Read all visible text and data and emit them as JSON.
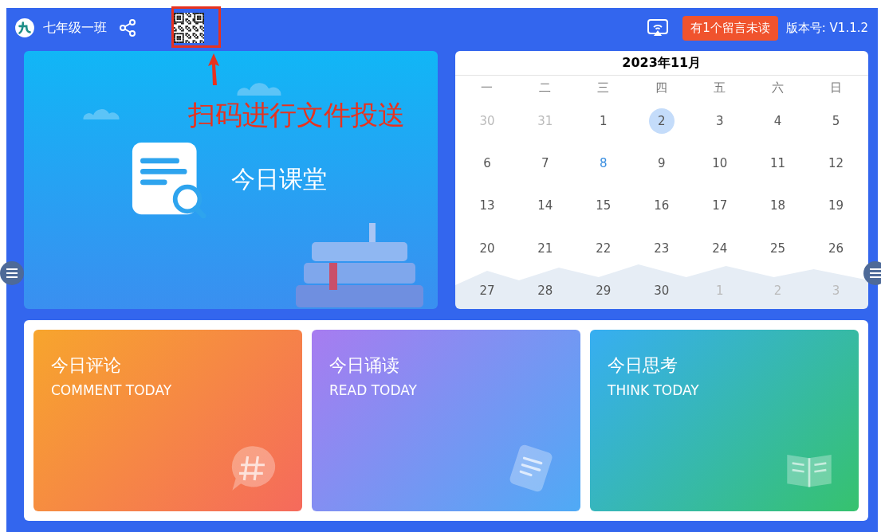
{
  "header": {
    "class_name": "七年级一班",
    "message_badge": "有1个留言未读",
    "version": "版本号: V1.1.2"
  },
  "annotation": {
    "text": "扫码进行文件投送"
  },
  "today_card": {
    "title": "今日课堂"
  },
  "calendar": {
    "title": "2023年11月",
    "weekdays": [
      "一",
      "二",
      "三",
      "四",
      "五",
      "六",
      "日"
    ],
    "weeks": [
      [
        {
          "label": "30",
          "outside": true,
          "selected": false,
          "marked": false
        },
        {
          "label": "31",
          "outside": true,
          "selected": false,
          "marked": false
        },
        {
          "label": "1",
          "outside": false,
          "selected": false,
          "marked": false
        },
        {
          "label": "2",
          "outside": false,
          "selected": true,
          "marked": false
        },
        {
          "label": "3",
          "outside": false,
          "selected": false,
          "marked": false
        },
        {
          "label": "4",
          "outside": false,
          "selected": false,
          "marked": false
        },
        {
          "label": "5",
          "outside": false,
          "selected": false,
          "marked": false
        }
      ],
      [
        {
          "label": "6",
          "outside": false,
          "selected": false,
          "marked": false
        },
        {
          "label": "7",
          "outside": false,
          "selected": false,
          "marked": false
        },
        {
          "label": "8",
          "outside": false,
          "selected": false,
          "marked": true
        },
        {
          "label": "9",
          "outside": false,
          "selected": false,
          "marked": false
        },
        {
          "label": "10",
          "outside": false,
          "selected": false,
          "marked": false
        },
        {
          "label": "11",
          "outside": false,
          "selected": false,
          "marked": false
        },
        {
          "label": "12",
          "outside": false,
          "selected": false,
          "marked": false
        }
      ],
      [
        {
          "label": "13",
          "outside": false,
          "selected": false,
          "marked": false
        },
        {
          "label": "14",
          "outside": false,
          "selected": false,
          "marked": false
        },
        {
          "label": "15",
          "outside": false,
          "selected": false,
          "marked": false
        },
        {
          "label": "16",
          "outside": false,
          "selected": false,
          "marked": false
        },
        {
          "label": "17",
          "outside": false,
          "selected": false,
          "marked": false
        },
        {
          "label": "18",
          "outside": false,
          "selected": false,
          "marked": false
        },
        {
          "label": "19",
          "outside": false,
          "selected": false,
          "marked": false
        }
      ],
      [
        {
          "label": "20",
          "outside": false,
          "selected": false,
          "marked": false
        },
        {
          "label": "21",
          "outside": false,
          "selected": false,
          "marked": false
        },
        {
          "label": "22",
          "outside": false,
          "selected": false,
          "marked": false
        },
        {
          "label": "23",
          "outside": false,
          "selected": false,
          "marked": false
        },
        {
          "label": "24",
          "outside": false,
          "selected": false,
          "marked": false
        },
        {
          "label": "25",
          "outside": false,
          "selected": false,
          "marked": false
        },
        {
          "label": "26",
          "outside": false,
          "selected": false,
          "marked": false
        }
      ],
      [
        {
          "label": "27",
          "outside": false,
          "selected": false,
          "marked": false
        },
        {
          "label": "28",
          "outside": false,
          "selected": false,
          "marked": false
        },
        {
          "label": "29",
          "outside": false,
          "selected": false,
          "marked": false
        },
        {
          "label": "30",
          "outside": false,
          "selected": false,
          "marked": false
        },
        {
          "label": "1",
          "outside": true,
          "selected": false,
          "marked": false
        },
        {
          "label": "2",
          "outside": true,
          "selected": false,
          "marked": false
        },
        {
          "label": "3",
          "outside": true,
          "selected": false,
          "marked": false
        }
      ]
    ]
  },
  "activity_cards": [
    {
      "kind": "comment",
      "title": "今日评论",
      "subtitle": "COMMENT TODAY"
    },
    {
      "kind": "read",
      "title": "今日诵读",
      "subtitle": "READ TODAY"
    },
    {
      "kind": "think",
      "title": "今日思考",
      "subtitle": "THINK TODAY"
    }
  ]
}
